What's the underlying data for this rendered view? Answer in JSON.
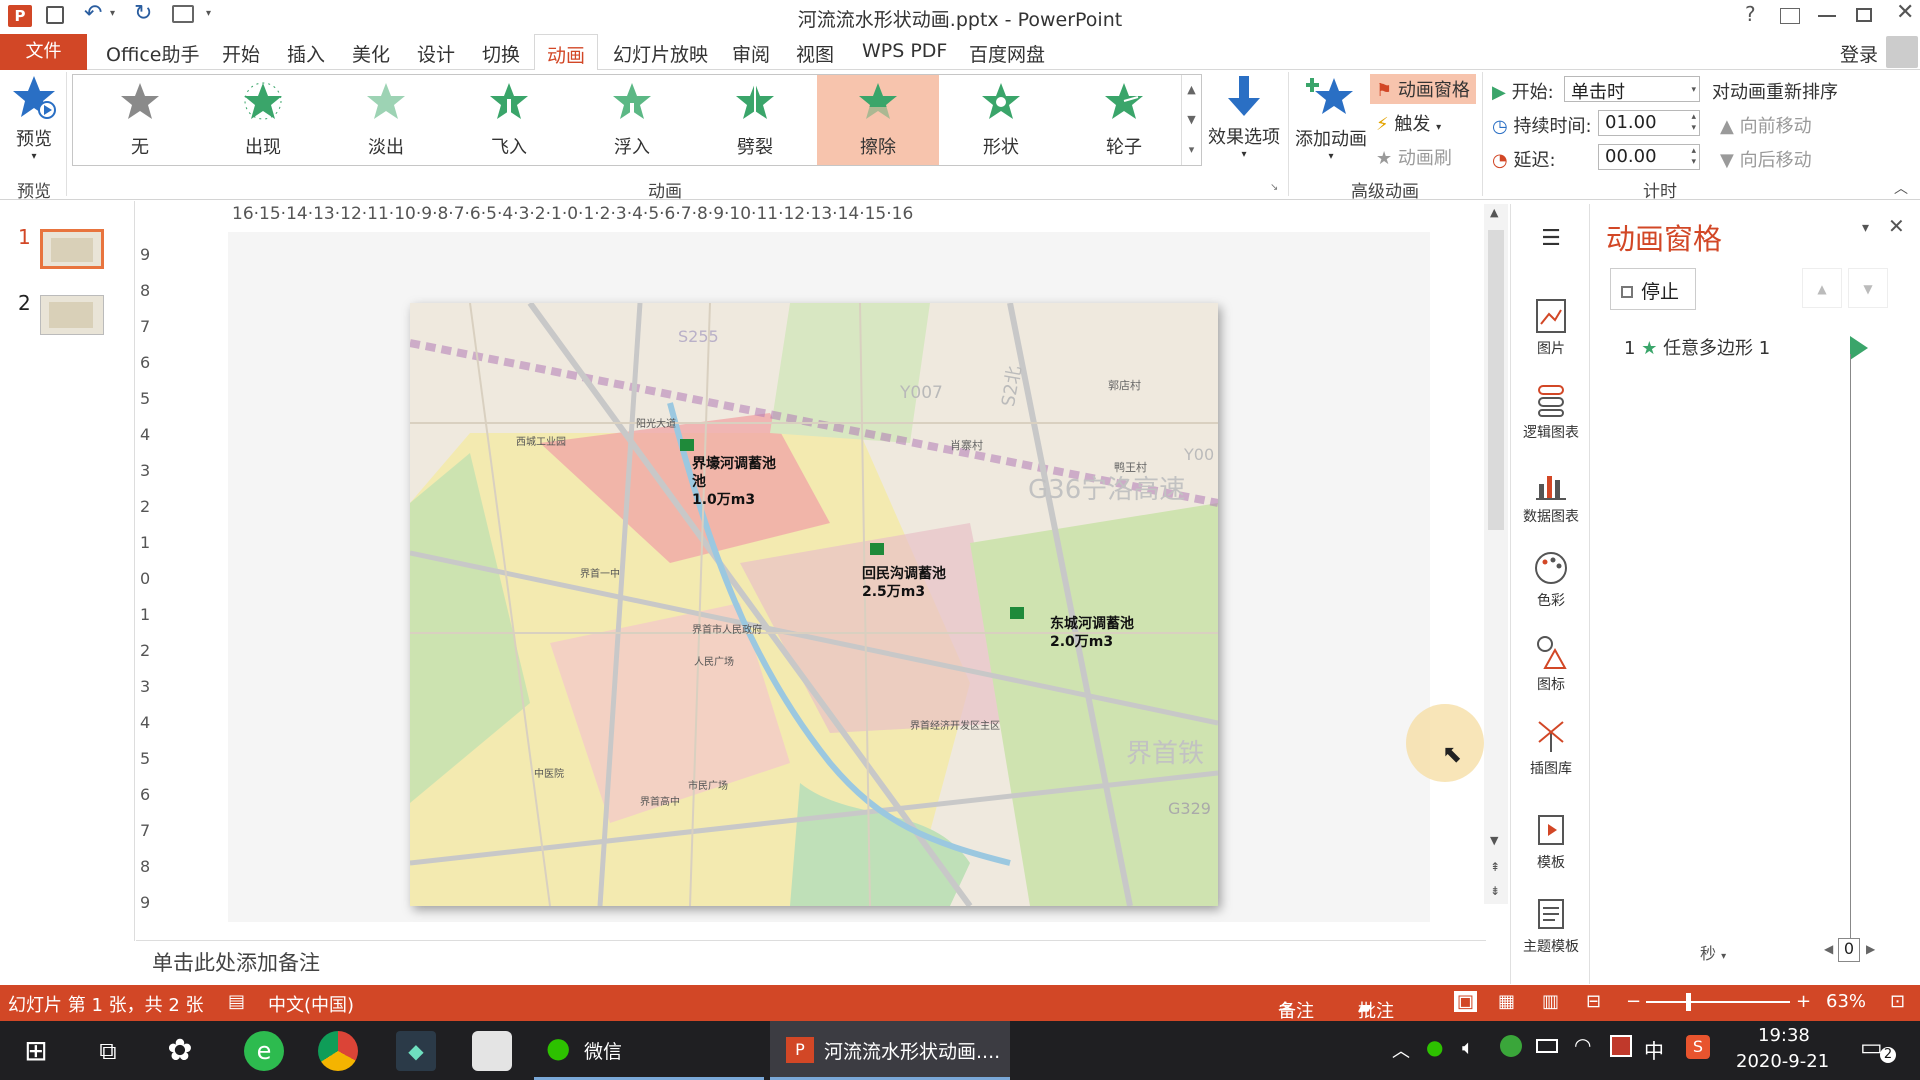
{
  "window": {
    "title": "河流流水形状动画.pptx - PowerPoint",
    "login": "登录"
  },
  "menu": {
    "file": "文件",
    "tabs": [
      "Office助手",
      "开始",
      "插入",
      "美化",
      "设计",
      "切换",
      "动画",
      "幻灯片放映",
      "审阅",
      "视图",
      "WPS PDF",
      "百度网盘"
    ],
    "active": "动画"
  },
  "ribbon": {
    "preview": {
      "label": "预览",
      "group": "预览"
    },
    "animations": [
      "无",
      "出现",
      "淡出",
      "飞入",
      "浮入",
      "劈裂",
      "擦除",
      "形状",
      "轮子"
    ],
    "selected_animation": "擦除",
    "animation_group": "动画",
    "effect_options": "效果选项",
    "add_animation": "添加动画",
    "animation_pane_btn": "动画窗格",
    "trigger": "触发",
    "anim_painter": "动画刷",
    "advanced_group": "高级动画",
    "start_label": "开始:",
    "start_value": "单击时",
    "duration_label": "持续时间:",
    "duration_value": "01.00",
    "delay_label": "延迟:",
    "delay_value": "00.00",
    "reorder_title": "对动画重新排序",
    "move_earlier": "向前移动",
    "move_later": "向后移动",
    "timing_group": "计时"
  },
  "slides": {
    "numbers": [
      "1",
      "2"
    ],
    "selected": "1"
  },
  "ruler": {
    "h": "16·15·14·13·12·11·10·9·8·7·6·5·4·3·2·1·0·1·2·3·4·5·6·7·8·9·10·11·12·13·14·15·16",
    "v": [
      "9",
      "8",
      "7",
      "6",
      "5",
      "4",
      "3",
      "2",
      "1",
      "0",
      "1",
      "2",
      "3",
      "4",
      "5",
      "6",
      "7",
      "8",
      "9"
    ]
  },
  "map": {
    "labels": [
      {
        "text": "界壕河调蓄池",
        "sub": "池",
        "vol": "1.0万m3"
      },
      {
        "text": "回民沟调蓄池",
        "vol": "2.5万m3"
      },
      {
        "text": "东城河调蓄池",
        "vol": "2.0万m3"
      }
    ],
    "road_labels": [
      "S255",
      "Y007",
      "G36宁洛高速",
      "G329",
      "Y00",
      "S2北",
      "郭店村",
      "鸭王村",
      "肖寨村",
      "界首铁",
      "人民广场",
      "界首市人民政府",
      "界首高中",
      "界首一中",
      "界首经济开发区主区",
      "市民广场",
      "中医院",
      "阳光大道",
      "西城工业园"
    ]
  },
  "side_tools": [
    "图片",
    "逻辑图表",
    "数据图表",
    "色彩",
    "图标",
    "插图库",
    "模板",
    "主题模板"
  ],
  "anim_pane": {
    "title": "动画窗格",
    "stop": "停止",
    "item_index": "1",
    "item_label": "任意多边形 1",
    "seconds": "秒",
    "time_value": "0"
  },
  "notes": {
    "placeholder": "单击此处添加备注"
  },
  "status": {
    "slide_info": "幻灯片 第 1 张，共 2 张",
    "language": "中文(中国)",
    "notes": "备注",
    "comments": "批注",
    "zoom": "63%"
  },
  "taskbar": {
    "wechat": "微信",
    "ppt_task": "河流流水形状动画....",
    "time": "19:38",
    "date": "2020-9-21",
    "ime": "中",
    "notif_count": "2"
  },
  "colors": {
    "accent": "#d24726",
    "star_green": "#3aa56a",
    "selected_tile": "#f7c4ad",
    "anim_pane_title": "#d24726"
  }
}
